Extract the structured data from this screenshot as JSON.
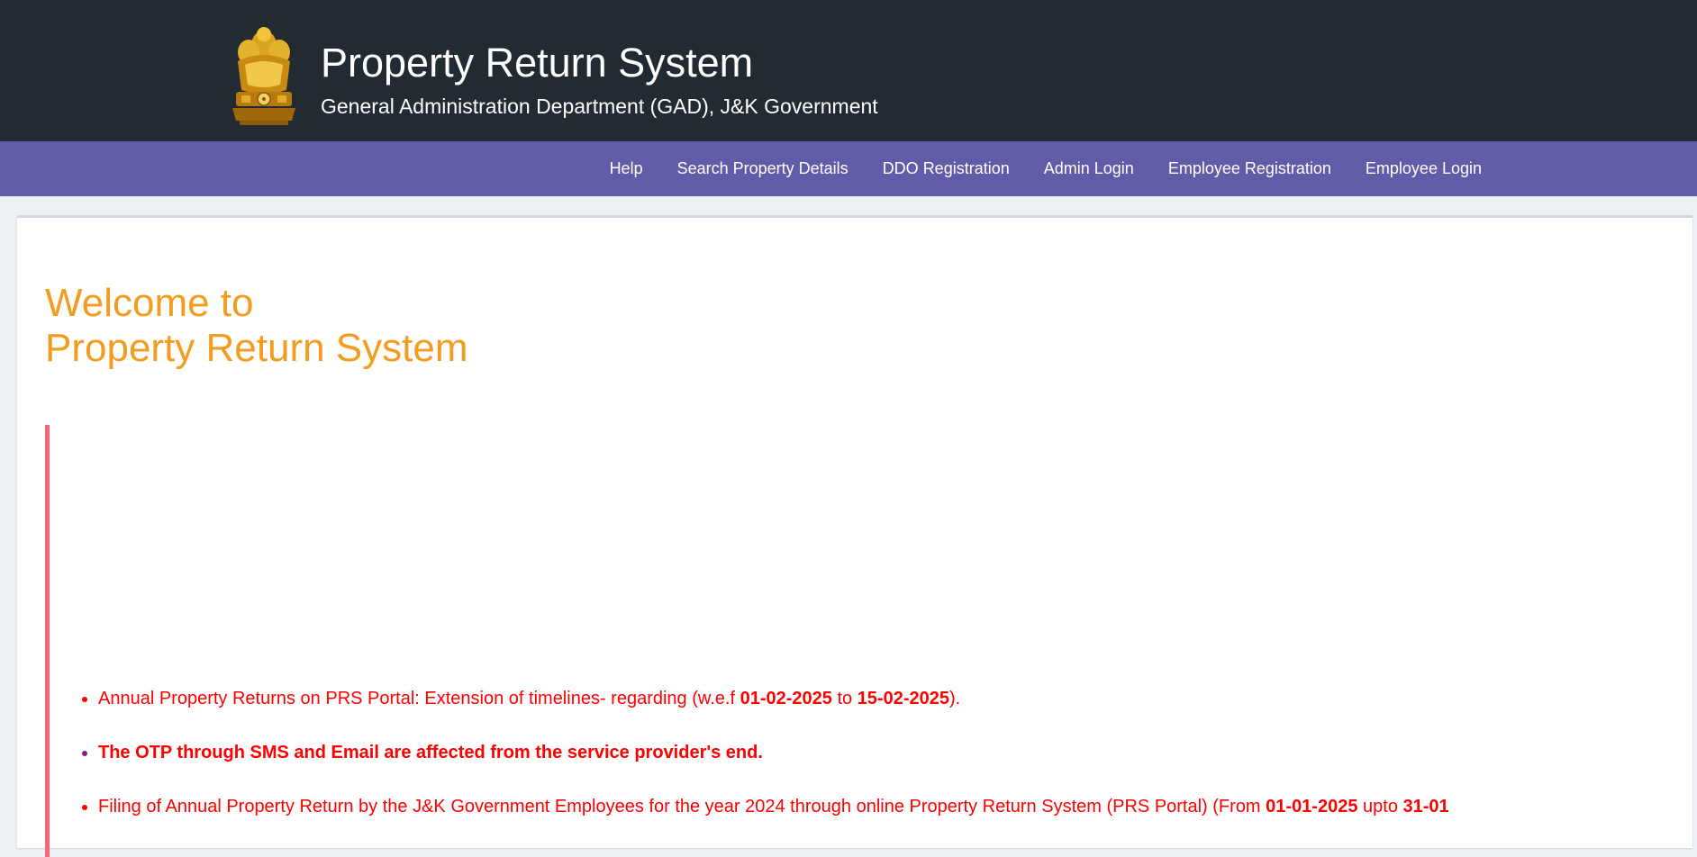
{
  "header": {
    "title": "Property Return System",
    "subtitle": "General Administration Department (GAD), J&K Government",
    "emblem_icon": "national-emblem-icon"
  },
  "nav": {
    "items": [
      {
        "label": "Help"
      },
      {
        "label": "Search Property Details"
      },
      {
        "label": "DDO Registration"
      },
      {
        "label": "Admin Login"
      },
      {
        "label": "Employee Registration"
      },
      {
        "label": "Employee Login"
      }
    ]
  },
  "welcome": {
    "line1": "Welcome to",
    "line2": "Property Return System"
  },
  "notices": [
    {
      "prefix": "Annual Property Returns on PRS Portal: Extension of timelines- regarding (w.e.f ",
      "date_from": "01-02-2025",
      "connector": " to ",
      "date_to": "15-02-2025",
      "suffix": ")."
    },
    {
      "text": "The OTP through SMS and Email are affected from the service provider's end."
    },
    {
      "prefix": "Filing of Annual Property Return by the J&K Government Employees for the year 2024 through online Property Return System (PRS Portal) (From ",
      "date_from": "01-01-2025",
      "connector": " upto ",
      "date_to": "31-01"
    }
  ],
  "colors": {
    "header_bg": "#222b32",
    "nav_bg": "#605ca8",
    "welcome_text": "#f39c1f",
    "notice_text": "#ff0000",
    "callout_border": "#f56977"
  }
}
